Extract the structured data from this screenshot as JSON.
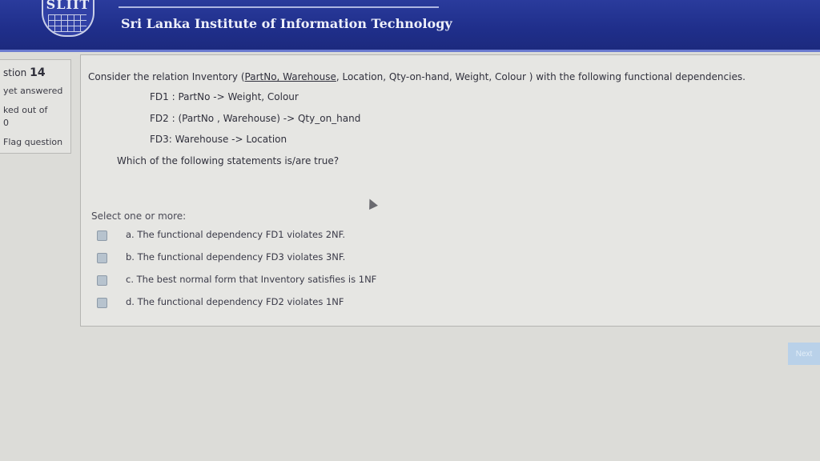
{
  "header": {
    "logo_text": "SLIIT",
    "institute_name": "Sri Lanka Institute of Information Technology"
  },
  "info": {
    "question_prefix": "stion",
    "question_number": "14",
    "state": "yet answered",
    "marks_label": "ked out of",
    "marks_value": "0",
    "flag_label": "Flag question"
  },
  "question": {
    "intro": "Consider the relation Inventory (",
    "key_attrs": "PartNo, Warehouse",
    "rest": ", Location, Qty-on-hand, Weight, Colour ) with the following functional dependencies.",
    "fds": [
      "FD1 : PartNo -> Weight, Colour",
      "FD2 : (PartNo , Warehouse) -> Qty_on_hand",
      "FD3: Warehouse -> Location"
    ],
    "prompt": "Which of the following statements is/are true?"
  },
  "answers": {
    "select_label": "Select one or more:",
    "options": [
      {
        "label": "a. The functional dependency FD1 violates 2NF.",
        "checked": false
      },
      {
        "label": "b. The functional dependency FD3 violates 3NF.",
        "checked": false
      },
      {
        "label": "c. The best normal form that Inventory satisfies is 1NF",
        "checked": false
      },
      {
        "label": "d. The functional dependency FD2 violates 1NF",
        "checked": false
      }
    ]
  },
  "navigation": {
    "next_label": "Next"
  },
  "colors": {
    "header_bg": "#1f2e8a",
    "checkbox": "#b7c3ce",
    "next_button": "#b9d1e9"
  }
}
